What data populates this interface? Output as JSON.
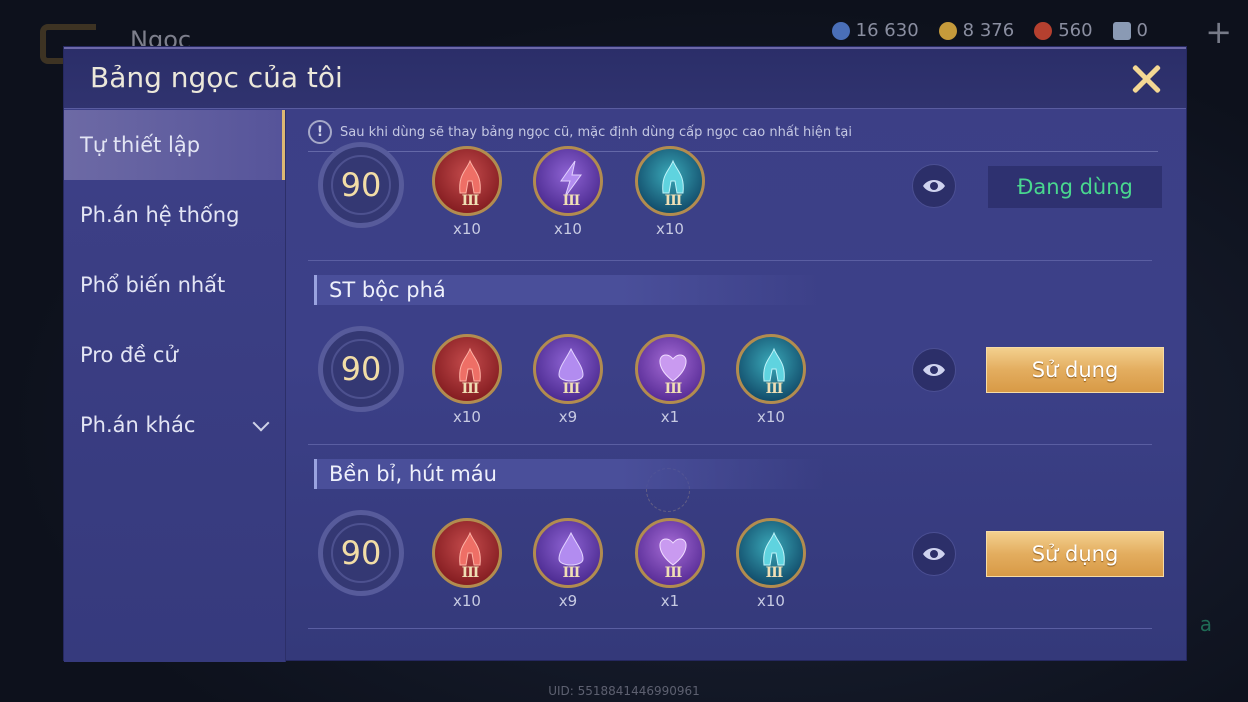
{
  "background": {
    "title": "Ngọc",
    "uid": "UID: 5518841446990961",
    "currencies": [
      {
        "name": "coin-blue",
        "value": "16 630",
        "color": "#4a6fb8"
      },
      {
        "name": "coin-gold",
        "value": "8 376",
        "color": "#c59a3b"
      },
      {
        "name": "gem-red",
        "value": "560",
        "color": "#b5402f"
      },
      {
        "name": "voucher",
        "value": "0",
        "color": "#8a9ab4"
      }
    ],
    "plus_label": "+",
    "corner_text": "a"
  },
  "modal": {
    "title": "Bảng ngọc của tôi",
    "close_icon": "close-icon"
  },
  "sidebar": {
    "items": [
      {
        "label": "Tự thiết lập",
        "active": true
      },
      {
        "label": "Ph.án hệ thống",
        "active": false
      },
      {
        "label": "Phổ biến nhất",
        "active": false
      },
      {
        "label": "Pro đề cử",
        "active": false
      },
      {
        "label": "Ph.án khác",
        "active": false,
        "has_dropdown": true
      }
    ]
  },
  "notice": {
    "icon": "!",
    "text": "Sau khi dùng sẽ thay bảng ngọc cũ, mặc định dùng cấp ngọc cao nhất hiện tại"
  },
  "sets": [
    {
      "title": "",
      "level": "90",
      "gems": [
        {
          "color": "red",
          "tier": "III",
          "count": "x10"
        },
        {
          "color": "purple",
          "tier": "III",
          "count": "x10"
        },
        {
          "color": "teal",
          "tier": "III",
          "count": "x10"
        }
      ],
      "action": "Đang dùng",
      "in_use": true
    },
    {
      "title": "ST bộc phá",
      "level": "90",
      "gems": [
        {
          "color": "red",
          "tier": "III",
          "count": "x10"
        },
        {
          "color": "purple",
          "tier": "III",
          "count": "x9"
        },
        {
          "color": "pink",
          "tier": "III",
          "count": "x1"
        },
        {
          "color": "teal",
          "tier": "III",
          "count": "x10"
        }
      ],
      "action": "Sử dụng",
      "in_use": false
    },
    {
      "title": "Bền bỉ, hút máu",
      "level": "90",
      "gems": [
        {
          "color": "red",
          "tier": "III",
          "count": "x10"
        },
        {
          "color": "purple",
          "tier": "III",
          "count": "x9"
        },
        {
          "color": "pink",
          "tier": "III",
          "count": "x1"
        },
        {
          "color": "teal",
          "tier": "III",
          "count": "x10"
        }
      ],
      "action": "Sử dụng",
      "in_use": false
    }
  ],
  "colors": {
    "accent_gold": "#f4d894",
    "in_use_green": "#49d88f",
    "modal_bg": "#3c4088"
  }
}
